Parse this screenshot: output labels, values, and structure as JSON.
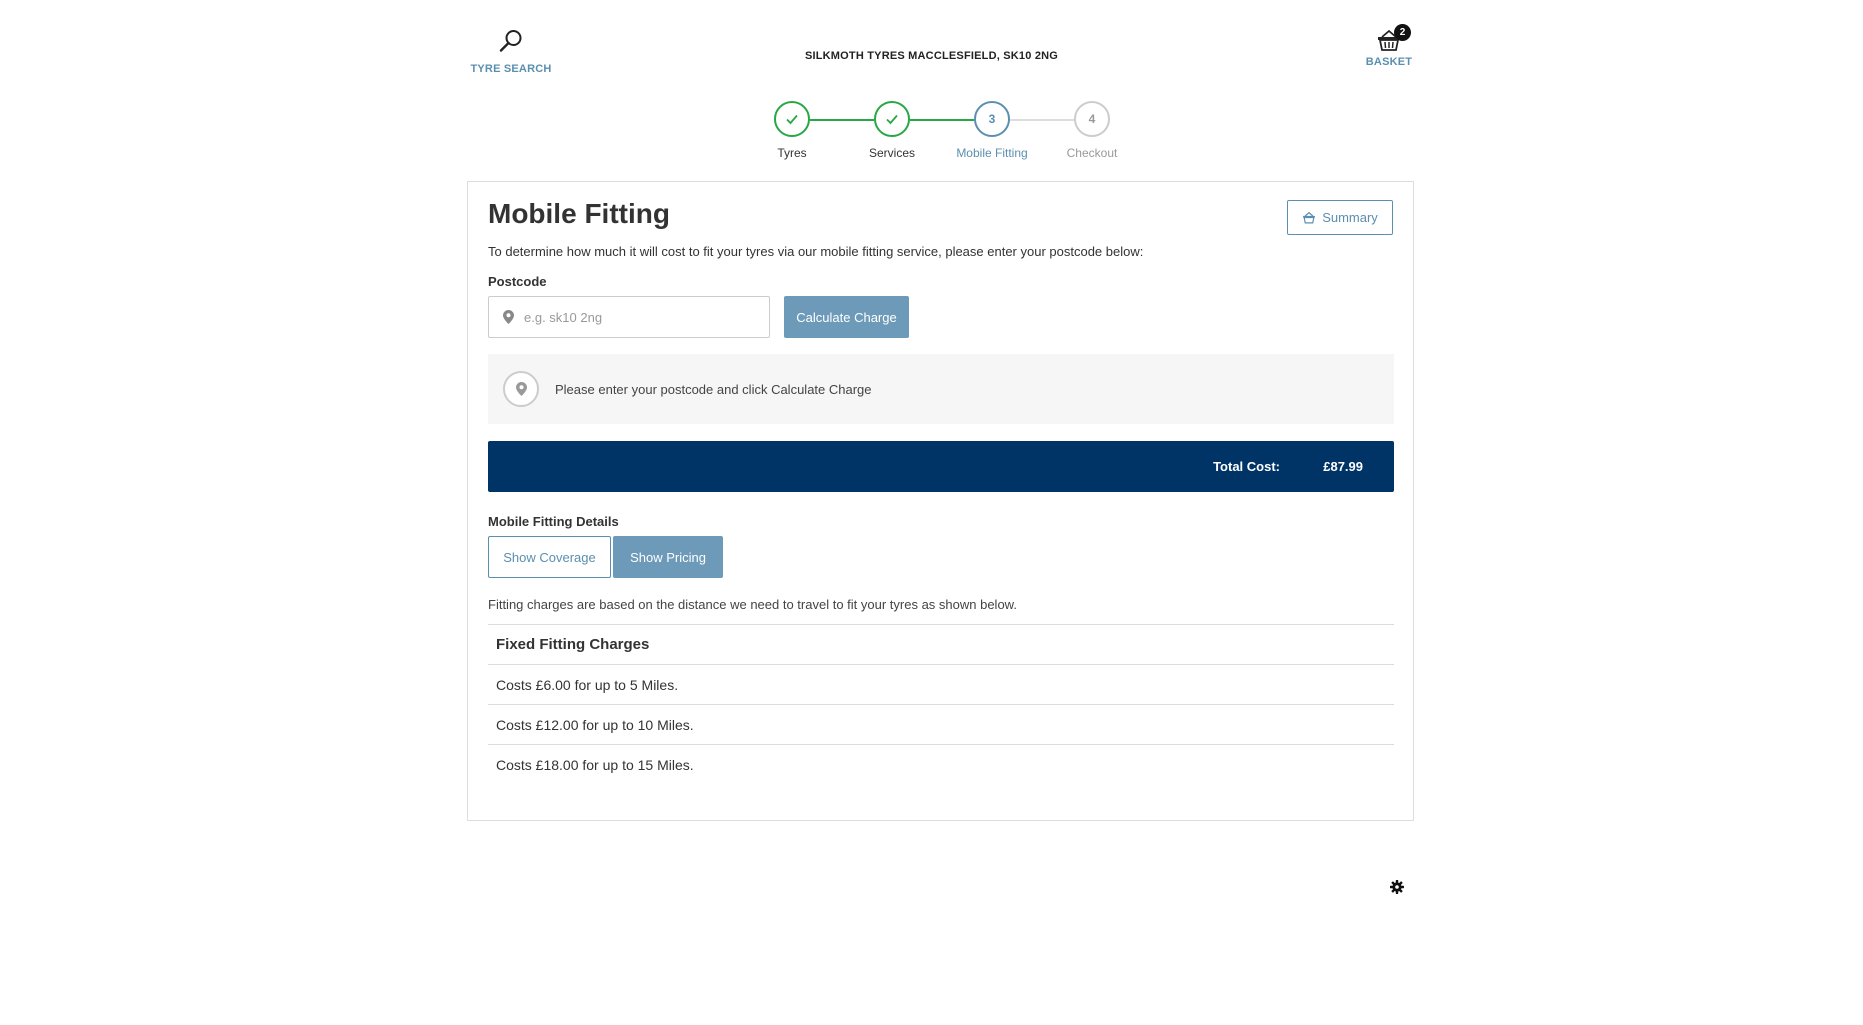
{
  "header": {
    "tyre_search_label": "TYRE SEARCH",
    "tyre_search_icon": "search-icon",
    "store_name": "SILKMOTH TYRES MACCLESFIELD, SK10 2NG",
    "basket_label": "BASKET",
    "basket_icon": "basket-icon",
    "basket_count": "2"
  },
  "stepper": {
    "steps": [
      {
        "label": "Tyres",
        "state": "done",
        "marker": "✓"
      },
      {
        "label": "Services",
        "state": "done",
        "marker": "✓"
      },
      {
        "label": "Mobile Fitting",
        "state": "active",
        "marker": "3"
      },
      {
        "label": "Checkout",
        "state": "todo",
        "marker": "4"
      }
    ]
  },
  "card": {
    "title": "Mobile Fitting",
    "summary_label": "Summary",
    "intro": "To determine how much it will cost to fit your tyres via our mobile fitting service, please enter your postcode below:",
    "postcode_label": "Postcode",
    "postcode_value": "",
    "postcode_placeholder": "e.g. sk10 2ng",
    "calculate_label": "Calculate Charge",
    "info_message": "Please enter your postcode and click Calculate Charge",
    "total_label": "Total Cost:",
    "total_value": "£87.99",
    "details_label": "Mobile Fitting Details",
    "show_coverage_label": "Show Coverage",
    "show_pricing_label": "Show Pricing",
    "note": "Fitting charges are based on the distance we need to travel to fit your tyres as shown below.",
    "table_header": "Fixed Fitting Charges",
    "rows": [
      "Costs £6.00 for up to 5 Miles.",
      "Costs £12.00 for up to 10 Miles.",
      "Costs £18.00 for up to 15 Miles."
    ]
  },
  "colors": {
    "accent": "#5b8fb0",
    "button": "#6c9ab8",
    "success": "#28a745",
    "total_bar": "#003366"
  }
}
